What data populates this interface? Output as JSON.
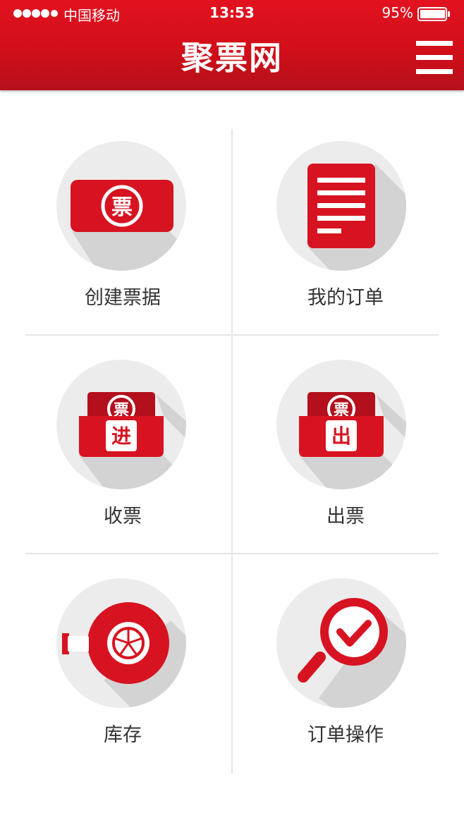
{
  "status_bar": {
    "carrier": "中国移动",
    "time": "13:53",
    "battery": "95%",
    "battery_level": 0.95,
    "signal_dots": 5
  },
  "header": {
    "title": "聚票网",
    "menu_icon": "hamburger-menu-icon"
  },
  "colors": {
    "brand_red": "#d71321",
    "dark_red": "#b5101b",
    "circle_bg": "#ececec",
    "shadow": "#d3d3d3",
    "label_text": "#333333",
    "divider": "#e6e6e6"
  },
  "tiles": [
    {
      "label": "创建票据",
      "icon": "create-ticket-icon",
      "icon_char": "票"
    },
    {
      "label": "我的订单",
      "icon": "order-list-icon"
    },
    {
      "label": "收票",
      "icon": "receive-ticket-icon",
      "icon_char": "进",
      "stamp_char": "票"
    },
    {
      "label": "出票",
      "icon": "issue-ticket-icon",
      "icon_char": "出",
      "stamp_char": "票"
    },
    {
      "label": "库存",
      "icon": "inventory-icon"
    },
    {
      "label": "订单操作",
      "icon": "order-search-check-icon"
    }
  ]
}
